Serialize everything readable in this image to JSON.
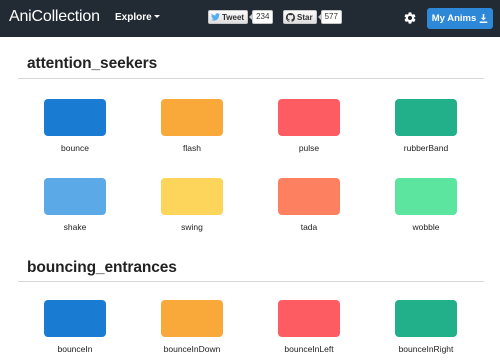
{
  "navbar": {
    "brand": "AniCollection",
    "explore_label": "Explore",
    "tweet": {
      "label": "Tweet",
      "count": "234"
    },
    "star": {
      "label": "Star",
      "count": "577"
    },
    "my_anims_label": "My Anims"
  },
  "colors": {
    "navbar_bg": "#222a33",
    "primary_button": "#2e88d8",
    "blue": "#1a7bd2",
    "orange": "#f9a83a",
    "red": "#fd5c63",
    "green": "#21b089",
    "light_blue": "#5ba9e6",
    "yellow": "#fdd55a",
    "salmon": "#fd8060",
    "mint": "#5ce59f"
  },
  "sections": [
    {
      "title": "attention_seekers",
      "items": [
        {
          "label": "bounce",
          "color": "#1a7bd2"
        },
        {
          "label": "flash",
          "color": "#f9a83a"
        },
        {
          "label": "pulse",
          "color": "#fd5c63"
        },
        {
          "label": "rubberBand",
          "color": "#21b089"
        },
        {
          "label": "shake",
          "color": "#5ba9e6"
        },
        {
          "label": "swing",
          "color": "#fdd55a"
        },
        {
          "label": "tada",
          "color": "#fd8060"
        },
        {
          "label": "wobble",
          "color": "#5ce59f"
        }
      ]
    },
    {
      "title": "bouncing_entrances",
      "items": [
        {
          "label": "bounceIn",
          "color": "#1a7bd2"
        },
        {
          "label": "bounceInDown",
          "color": "#f9a83a"
        },
        {
          "label": "bounceInLeft",
          "color": "#fd5c63"
        },
        {
          "label": "bounceInRight",
          "color": "#21b089"
        }
      ]
    }
  ]
}
